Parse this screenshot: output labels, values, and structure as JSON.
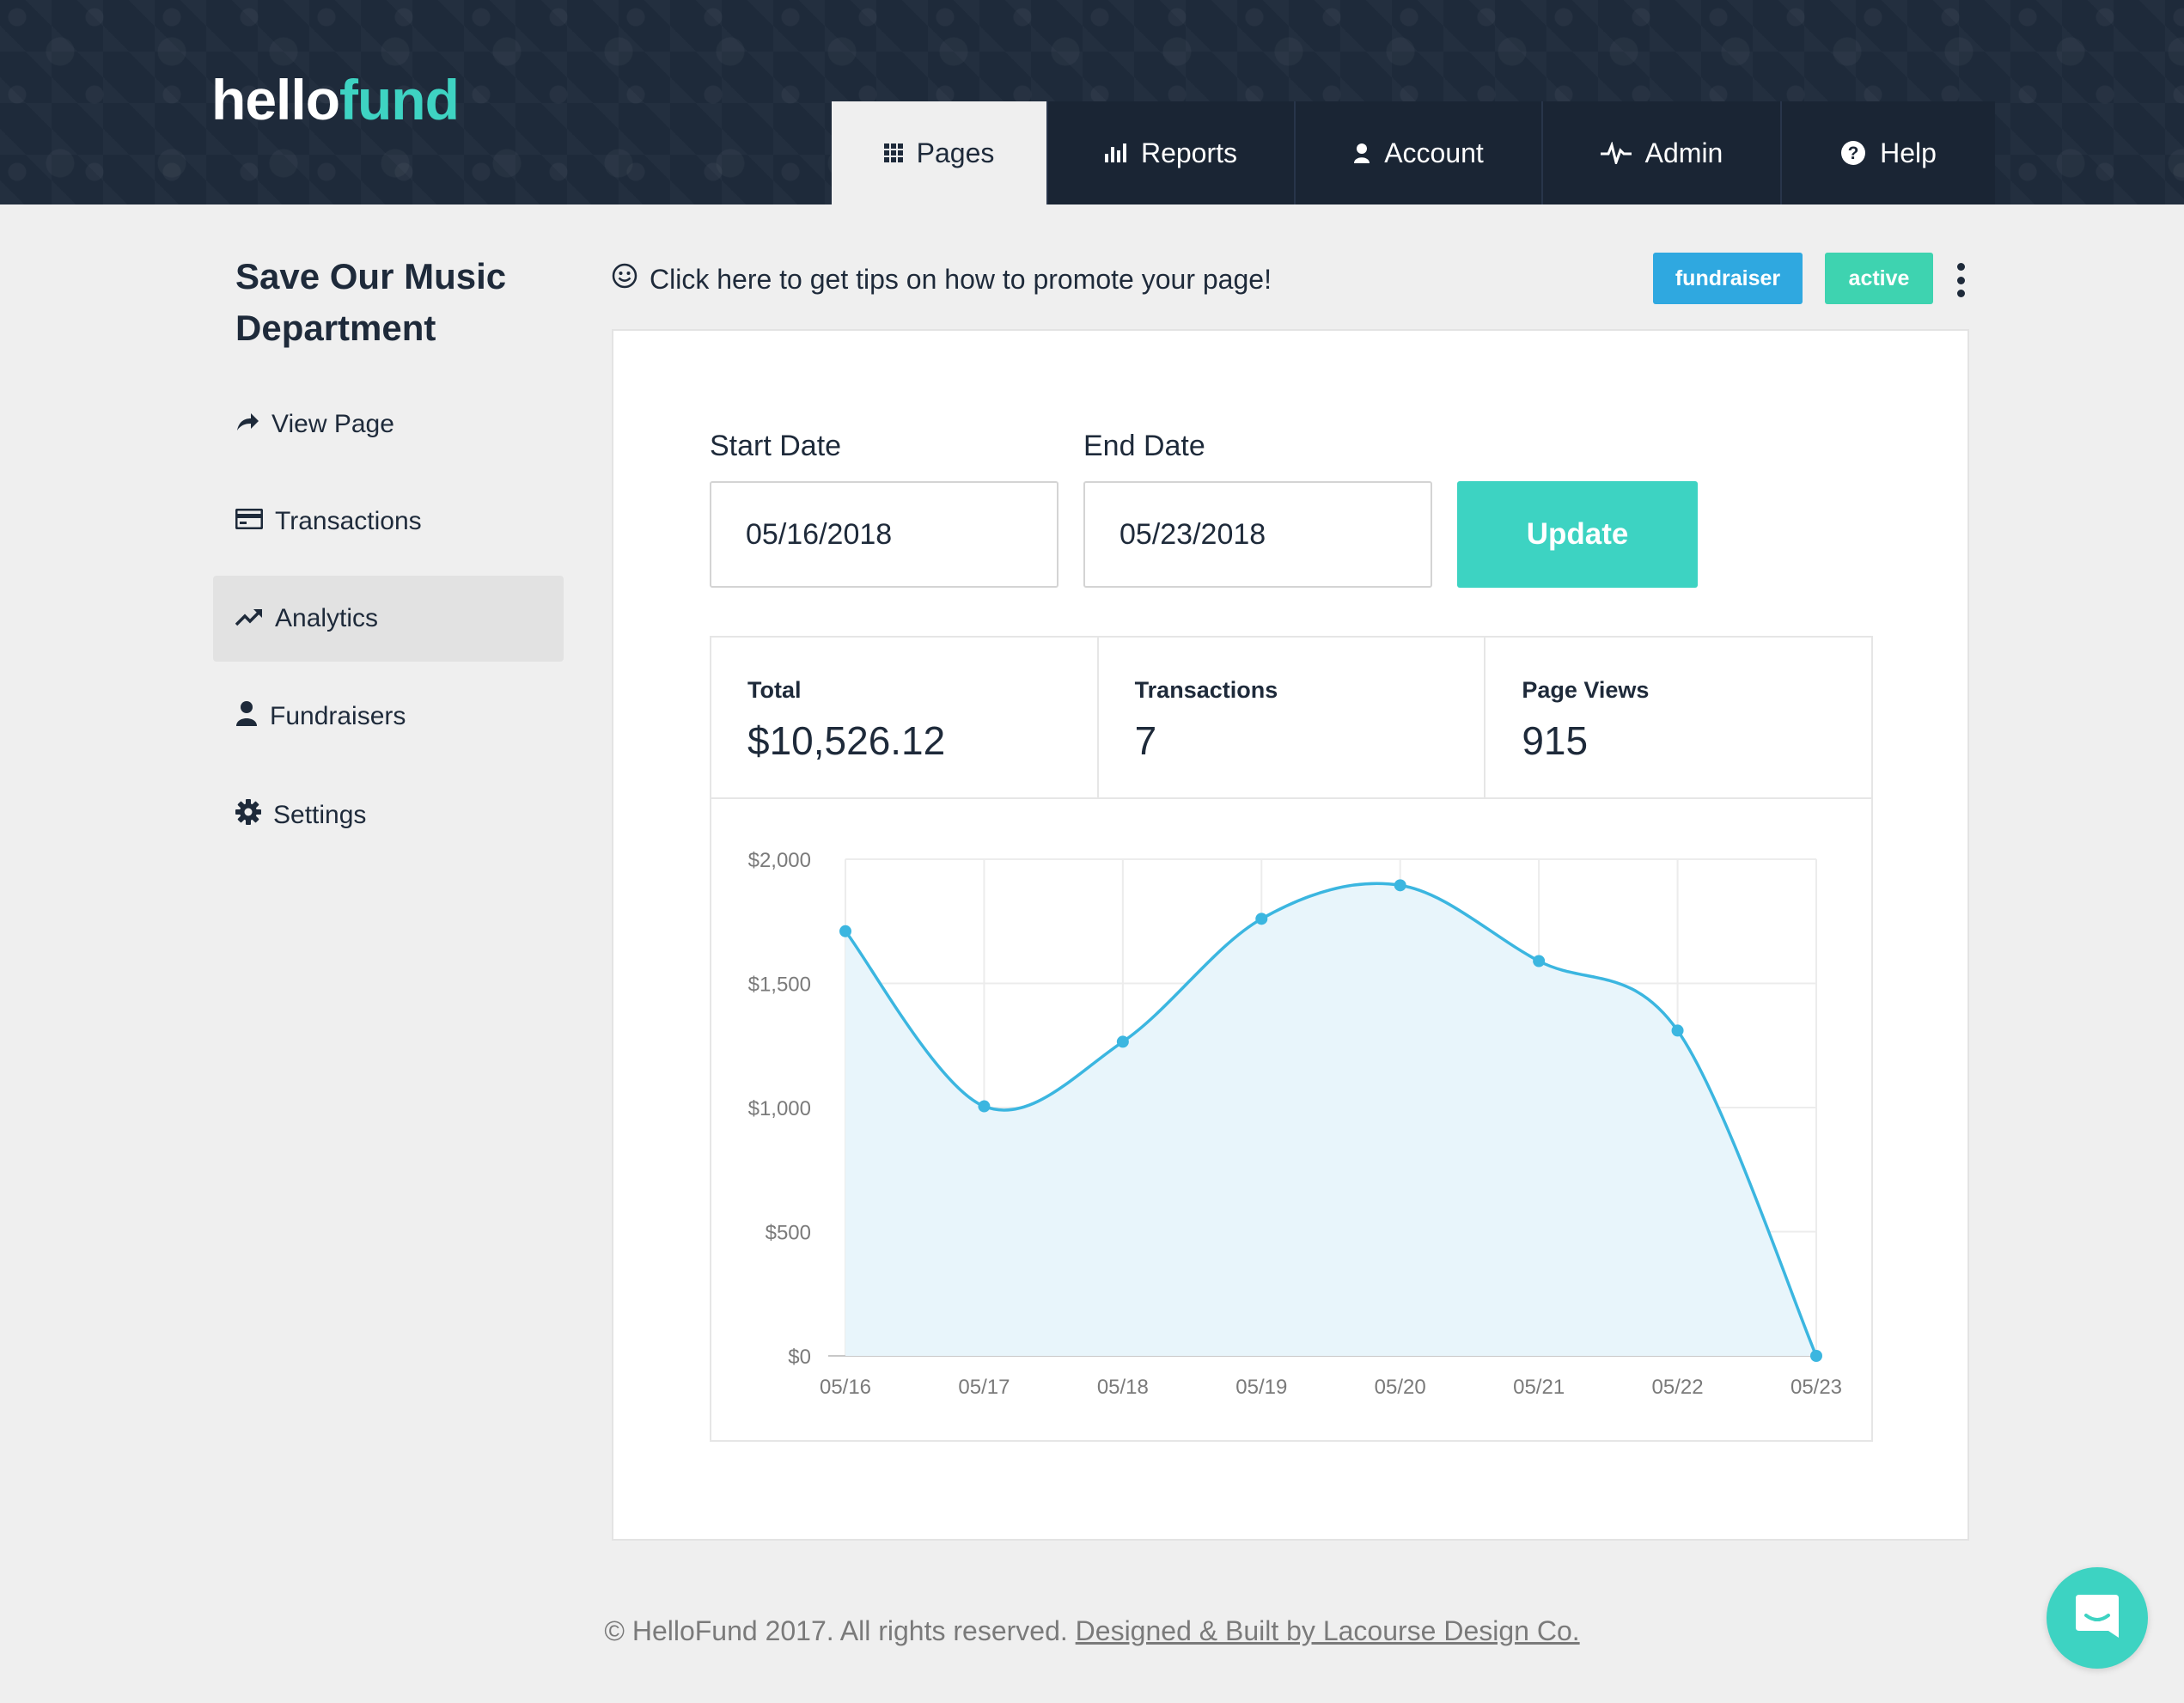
{
  "brand": {
    "part1": "hello",
    "part2": "fund",
    "accent_color": "#3ed3c2"
  },
  "nav": {
    "tabs": [
      {
        "label": "Pages",
        "icon": "grid-icon",
        "active": true
      },
      {
        "label": "Reports",
        "icon": "bar-chart-icon",
        "active": false
      },
      {
        "label": "Account",
        "icon": "user-icon",
        "active": false
      },
      {
        "label": "Admin",
        "icon": "pulse-icon",
        "active": false
      },
      {
        "label": "Help",
        "icon": "question-circle-icon",
        "active": false
      }
    ]
  },
  "sidebar": {
    "title": "Save Our Music Department",
    "items": [
      {
        "label": "View Page",
        "icon": "share-arrow-icon"
      },
      {
        "label": "Transactions",
        "icon": "credit-card-icon"
      },
      {
        "label": "Analytics",
        "icon": "trend-up-icon",
        "active": true
      },
      {
        "label": "Fundraisers",
        "icon": "user-icon"
      },
      {
        "label": "Settings",
        "icon": "gear-icon"
      }
    ]
  },
  "tips": {
    "text": "Click here to get tips on how to promote your page!",
    "icon": "smiley-icon"
  },
  "badges": {
    "type": "fundraiser",
    "status": "active"
  },
  "filters": {
    "start_label": "Start Date",
    "start_value": "05/16/2018",
    "end_label": "End Date",
    "end_value": "05/23/2018",
    "update_label": "Update"
  },
  "stats": {
    "total_label": "Total",
    "total_value": "$10,526.12",
    "transactions_label": "Transactions",
    "transactions_value": "7",
    "views_label": "Page Views",
    "views_value": "915"
  },
  "chart_data": {
    "type": "area",
    "categories": [
      "05/16",
      "05/17",
      "05/18",
      "05/19",
      "05/20",
      "05/21",
      "05/22",
      "05/23"
    ],
    "values": [
      1710,
      1005,
      1265,
      1760,
      1895,
      1590,
      1310,
      0
    ],
    "yticks": [
      "$0",
      "$500",
      "$1,000",
      "$1,500",
      "$2,000"
    ],
    "ylim": [
      0,
      2000
    ],
    "grid": true,
    "line_color": "#3bb6e0",
    "fill_color": "#e8f5fb"
  },
  "footer": {
    "copyright": "© HelloFund 2017. All rights reserved.",
    "credit": "Designed & Built by Lacourse Design Co."
  },
  "chat": {
    "icon": "chat-bubble-icon"
  }
}
